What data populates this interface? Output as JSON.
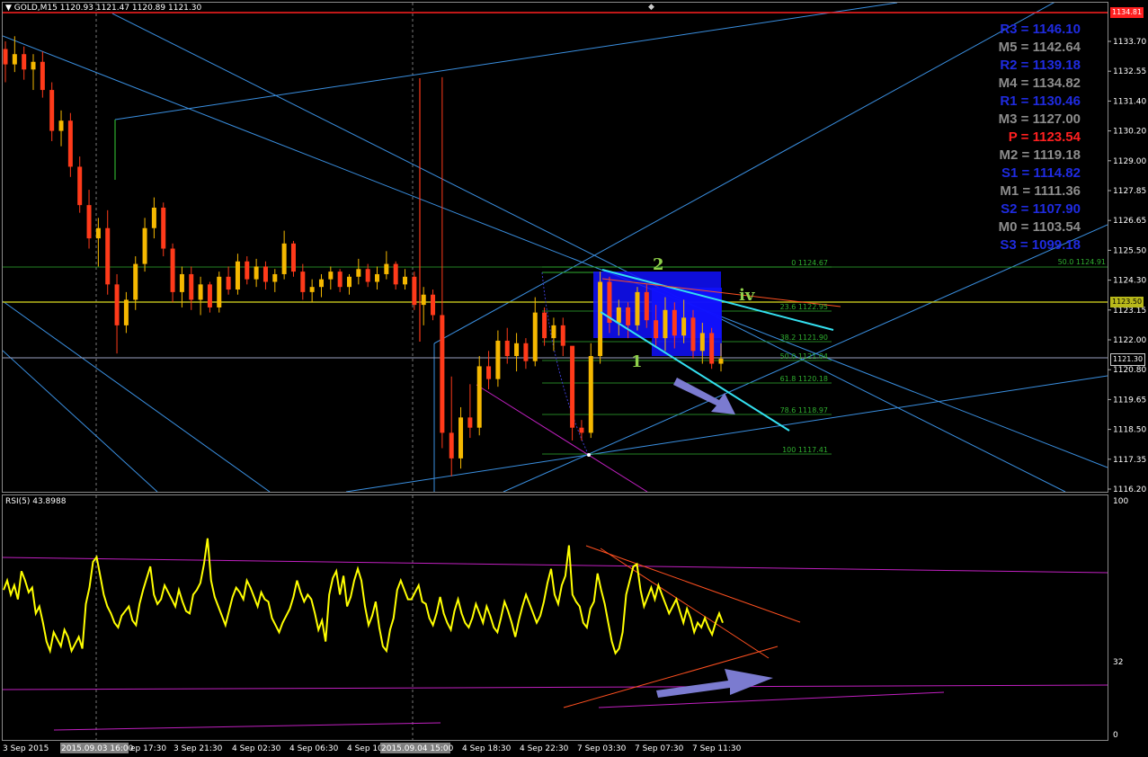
{
  "main": {
    "title_arrow": "▼",
    "title": "GOLD,M15",
    "ohlc": "1120.93 1121.47 1120.89 1121.30"
  },
  "rsi": {
    "title": "RSI(5) 43.8988",
    "levels": [
      "100",
      "32",
      "0"
    ]
  },
  "price_axis": {
    "ticks": [
      "1133.70",
      "1132.55",
      "1131.40",
      "1130.20",
      "1129.00",
      "1127.85",
      "1126.65",
      "1125.50",
      "1124.30",
      "1123.15",
      "1122.00",
      "1120.80",
      "1119.65",
      "1118.50",
      "1117.35",
      "1116.20"
    ],
    "top_tag": "1134.81",
    "hline_tag": "1123.50",
    "bid_tag": "1121.30"
  },
  "time_axis": {
    "ticks": [
      "3 Sep 2015",
      "2015.09.03 16:00",
      "ep 17:30",
      "3 Sep 21:30",
      "4 Sep 02:30",
      "4 Sep 06:30",
      "4 Sep 10",
      "2015.09.04 15:00",
      "4 Sep 18:30",
      "4 Sep 22:30",
      "7 Sep 03:30",
      "7 Sep 07:30",
      "7 Sep 11:30"
    ]
  },
  "pivots": [
    {
      "label": "R3",
      "value": "1146.10",
      "color": "#1f2be0"
    },
    {
      "label": "M5",
      "value": "1142.64",
      "color": "#8c8c8c"
    },
    {
      "label": "R2",
      "value": "1139.18",
      "color": "#1f2be0"
    },
    {
      "label": "M4",
      "value": "1134.82",
      "color": "#8c8c8c"
    },
    {
      "label": "R1",
      "value": "1130.46",
      "color": "#1f2be0"
    },
    {
      "label": "M3",
      "value": "1127.00",
      "color": "#8c8c8c"
    },
    {
      "label": "P",
      "value": "1123.54",
      "color": "#ff2020"
    },
    {
      "label": "M2",
      "value": "1119.18",
      "color": "#8c8c8c"
    },
    {
      "label": "S1",
      "value": "1114.82",
      "color": "#1f2be0"
    },
    {
      "label": "M1",
      "value": "1111.36",
      "color": "#8c8c8c"
    },
    {
      "label": "S2",
      "value": "1107.90",
      "color": "#1f2be0"
    },
    {
      "label": "M0",
      "value": "1103.54",
      "color": "#8c8c8c"
    },
    {
      "label": "S3",
      "value": "1099.18",
      "color": "#1f2be0"
    }
  ],
  "pivot_separator": " = ",
  "fib_levels": [
    "0 1124.67",
    "23.6 1122.95",
    "38.2 1121.90",
    "50.0 1121.04",
    "61.8 1120.18",
    "78.6 1118.97",
    "100 1117.41"
  ],
  "fib_extra": "50.0 1124.91",
  "waves": {
    "w1": "1",
    "w2": "2",
    "w4": "iv"
  },
  "colors": {
    "up_candle": "#f5b800",
    "down_candle": "#ff3a1a",
    "rsi_line": "#ffff00",
    "trend_blue": "#3a8fe0",
    "fib_green": "#2fae2f",
    "pivot_line": "#b8b81a",
    "box_blue": "#1010ff",
    "cyan": "#34e0f0",
    "magenta": "#c020c0",
    "arrow": "#7b7bd0"
  },
  "candles": [
    [
      1133.4,
      1133.7,
      1132.1,
      1132.8
    ],
    [
      1132.8,
      1133.9,
      1132.5,
      1133.2
    ],
    [
      1133.2,
      1133.5,
      1132.2,
      1132.6
    ],
    [
      1132.6,
      1133.2,
      1131.8,
      1132.9
    ],
    [
      1132.9,
      1133.3,
      1131.5,
      1131.8
    ],
    [
      1131.8,
      1132.1,
      1129.8,
      1130.2
    ],
    [
      1130.2,
      1131.0,
      1129.6,
      1130.6
    ],
    [
      1130.6,
      1130.9,
      1128.4,
      1128.8
    ],
    [
      1128.8,
      1129.2,
      1127.0,
      1127.3
    ],
    [
      1127.3,
      1127.9,
      1125.6,
      1126.0
    ],
    [
      1126.0,
      1126.8,
      1124.9,
      1126.4
    ],
    [
      1126.4,
      1127.1,
      1123.8,
      1124.2
    ],
    [
      1124.2,
      1124.6,
      1121.5,
      1122.6
    ],
    [
      1122.6,
      1123.9,
      1122.3,
      1123.6
    ],
    [
      1123.6,
      1125.3,
      1123.2,
      1125.0
    ],
    [
      1125.0,
      1126.8,
      1124.7,
      1126.4
    ],
    [
      1126.4,
      1127.6,
      1126.0,
      1127.2
    ],
    [
      1127.2,
      1127.4,
      1125.3,
      1125.6
    ],
    [
      1125.6,
      1125.8,
      1123.5,
      1123.9
    ],
    [
      1123.9,
      1124.9,
      1123.3,
      1124.6
    ],
    [
      1124.6,
      1124.9,
      1123.2,
      1123.6
    ],
    [
      1123.6,
      1124.5,
      1123.0,
      1124.2
    ],
    [
      1124.2,
      1124.3,
      1123.1,
      1123.3
    ],
    [
      1123.3,
      1124.7,
      1123.1,
      1124.5
    ],
    [
      1124.5,
      1124.9,
      1123.8,
      1124.0
    ],
    [
      1124.0,
      1125.4,
      1123.8,
      1125.1
    ],
    [
      1125.1,
      1125.3,
      1124.2,
      1124.4
    ],
    [
      1124.4,
      1125.2,
      1124.1,
      1124.9
    ],
    [
      1124.9,
      1125.1,
      1124.0,
      1124.3
    ],
    [
      1124.3,
      1124.8,
      1123.9,
      1124.6
    ],
    [
      1124.6,
      1126.3,
      1124.4,
      1125.8
    ],
    [
      1125.8,
      1125.9,
      1124.5,
      1124.7
    ],
    [
      1124.7,
      1125.0,
      1123.6,
      1123.9
    ],
    [
      1123.9,
      1124.4,
      1123.5,
      1124.1
    ],
    [
      1124.1,
      1124.6,
      1123.7,
      1124.4
    ],
    [
      1124.4,
      1124.9,
      1124.0,
      1124.7
    ],
    [
      1124.7,
      1124.8,
      1123.9,
      1124.1
    ],
    [
      1124.1,
      1124.6,
      1123.8,
      1124.5
    ],
    [
      1124.5,
      1125.2,
      1124.2,
      1124.8
    ],
    [
      1124.8,
      1125.0,
      1124.1,
      1124.3
    ],
    [
      1124.3,
      1124.9,
      1124.0,
      1124.6
    ],
    [
      1124.6,
      1125.5,
      1124.4,
      1125.0
    ],
    [
      1125.0,
      1125.1,
      1124.0,
      1124.2
    ],
    [
      1124.2,
      1124.8,
      1124.0,
      1124.5
    ],
    [
      1124.5,
      1124.7,
      1123.2,
      1123.4
    ],
    [
      1123.4,
      1124.1,
      1122.6,
      1123.8
    ],
    [
      1123.8,
      1124.0,
      1122.8,
      1123.0
    ],
    [
      1123.0,
      1132.3,
      1117.8,
      1118.4
    ],
    [
      1118.4,
      1120.6,
      1116.7,
      1117.4
    ],
    [
      1117.4,
      1119.4,
      1117.0,
      1119.0
    ],
    [
      1119.0,
      1120.3,
      1118.2,
      1118.6
    ],
    [
      1118.6,
      1121.4,
      1118.3,
      1121.0
    ],
    [
      1121.0,
      1121.6,
      1120.1,
      1120.5
    ],
    [
      1120.5,
      1122.4,
      1120.2,
      1122.0
    ],
    [
      1122.0,
      1122.5,
      1121.1,
      1121.4
    ],
    [
      1121.4,
      1122.3,
      1120.8,
      1121.9
    ],
    [
      1121.9,
      1122.1,
      1120.9,
      1121.2
    ],
    [
      1121.2,
      1123.7,
      1121.0,
      1123.1
    ],
    [
      1123.1,
      1123.3,
      1121.8,
      1122.1
    ],
    [
      1122.1,
      1122.9,
      1121.6,
      1122.6
    ],
    [
      1122.6,
      1122.9,
      1121.4,
      1121.8
    ],
    [
      1121.8,
      1118.7,
      1118.1,
      1118.6
    ],
    [
      1118.6,
      1118.9,
      1118.1,
      1118.4
    ],
    [
      1118.4,
      1121.9,
      1118.2,
      1121.4
    ],
    [
      1121.4,
      1124.7,
      1121.1,
      1124.3
    ],
    [
      1124.3,
      1124.5,
      1122.3,
      1122.7
    ],
    [
      1122.7,
      1123.6,
      1122.2,
      1123.3
    ],
    [
      1123.3,
      1123.5,
      1122.1,
      1122.6
    ],
    [
      1122.6,
      1124.1,
      1122.4,
      1123.9
    ],
    [
      1123.9,
      1124.2,
      1122.5,
      1122.8
    ],
    [
      1122.8,
      1123.4,
      1121.8,
      1122.1
    ],
    [
      1122.1,
      1123.7,
      1121.6,
      1123.2
    ],
    [
      1123.2,
      1123.5,
      1121.7,
      1122.2
    ],
    [
      1122.2,
      1123.6,
      1121.9,
      1122.9
    ],
    [
      1122.9,
      1123.2,
      1121.3,
      1121.6
    ],
    [
      1121.6,
      1122.7,
      1121.1,
      1122.3
    ],
    [
      1122.3,
      1122.5,
      1120.9,
      1121.1
    ],
    [
      1121.1,
      1121.9,
      1120.8,
      1121.3
    ]
  ],
  "rsi_values": [
    62,
    66,
    60,
    64,
    58,
    70,
    66,
    61,
    63,
    52,
    55,
    48,
    40,
    36,
    44,
    41,
    38,
    45,
    42,
    36,
    39,
    42,
    37,
    56,
    63,
    74,
    76,
    68,
    60,
    55,
    52,
    48,
    46,
    51,
    53,
    55,
    49,
    47,
    56,
    62,
    67,
    72,
    60,
    56,
    58,
    64,
    61,
    58,
    55,
    62,
    57,
    53,
    52,
    60,
    62,
    65,
    73,
    84,
    66,
    59,
    55,
    51,
    47,
    53,
    59,
    63,
    61,
    58,
    66,
    63,
    59,
    55,
    61,
    58,
    57,
    50,
    47,
    44,
    48,
    51,
    54,
    59,
    66,
    61,
    57,
    60,
    58,
    52,
    45,
    49,
    40,
    60,
    67,
    70,
    60,
    68,
    55,
    59,
    66,
    71,
    66,
    55,
    47,
    51,
    57,
    46,
    38,
    36,
    45,
    50,
    62,
    66,
    62,
    58,
    58,
    61,
    64,
    57,
    56,
    50,
    47,
    52,
    59,
    52,
    48,
    45,
    53,
    58,
    52,
    48,
    46,
    50,
    56,
    52,
    48,
    55,
    51,
    46,
    44,
    50,
    57,
    53,
    48,
    42,
    49,
    55,
    60,
    56,
    52,
    48,
    51,
    57,
    65,
    71,
    60,
    56,
    64,
    68,
    81,
    60,
    57,
    55,
    48,
    46,
    54,
    57,
    69,
    62,
    56,
    48,
    40,
    35,
    37,
    44,
    60,
    66,
    72,
    73,
    62,
    55,
    59,
    63,
    58,
    64,
    60,
    56,
    52,
    55,
    58,
    53,
    48,
    54,
    50,
    44,
    48,
    46,
    50,
    46,
    43,
    48,
    52,
    48
  ]
}
